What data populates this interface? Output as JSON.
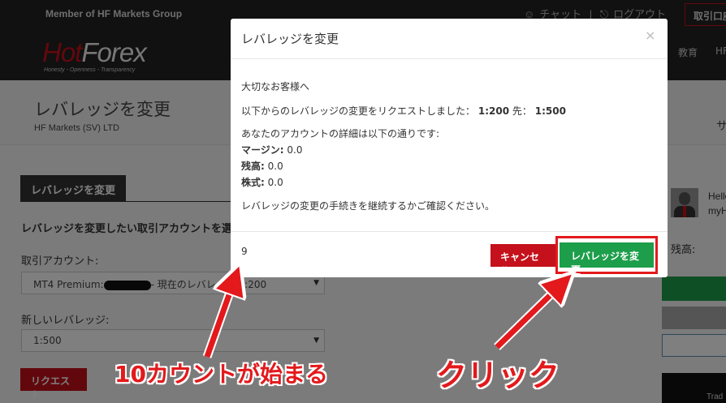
{
  "header": {
    "member_text": "Member of HF Markets Group",
    "logo": {
      "hot": "Hot",
      "forex": "Forex",
      "tagline": "Honesty - Openness - Transparency"
    },
    "chat": "チャット",
    "logout": "ログアウト",
    "separator": "|",
    "open_account": "取引口座",
    "nav_education": "教育",
    "nav_hf": "HF"
  },
  "page": {
    "title": "レバレッジを変更",
    "subtitle": "HF Markets (SV) LTD",
    "side_cut": "サ"
  },
  "form": {
    "tab_label": "レバレッジを変更",
    "lead": "レバレッジを変更したい取引アカウントを選択",
    "account_label": "取引アカウント:",
    "account_prefix": "MT4 Premium:",
    "account_suffix": "- 現在のレバレッジ 1:200",
    "new_leverage_label": "新しいレバレッジ:",
    "new_leverage_value": "1:500",
    "request_button": "リクエスト"
  },
  "sidebar": {
    "hello": "Hello",
    "myhf": "myHF",
    "balance_label": "残高:",
    "banner_text": "Trad"
  },
  "modal": {
    "title": "レバレッジを変更",
    "close": "×",
    "greeting": "大切なお客様へ",
    "request_text": "以下からのレバレッジの変更をリクエストしました：",
    "from_value": "1:200",
    "to_label": "先：",
    "to_value": "1:500",
    "details_text": "あなたのアカウントの詳細は以下の通りです:",
    "margin_label": "マージン:",
    "margin_value": "0.0",
    "balance_label": "残高:",
    "balance_value": "0.0",
    "equity_label": "株式:",
    "equity_value": "0.0",
    "confirm_text": "レバレッジの変更の手続きを継続するかご確認ください。",
    "countdown": "9",
    "cancel_button": "キャンセル",
    "change_button": "レバレッジを変更"
  },
  "annotations": {
    "countdown_note": "10カウントが始まる",
    "click_note": "クリック",
    "color": "#e3191c"
  },
  "colors": {
    "brand_red": "#c5111b",
    "confirm_green": "#1d9e4b",
    "header_bg": "#222222"
  }
}
